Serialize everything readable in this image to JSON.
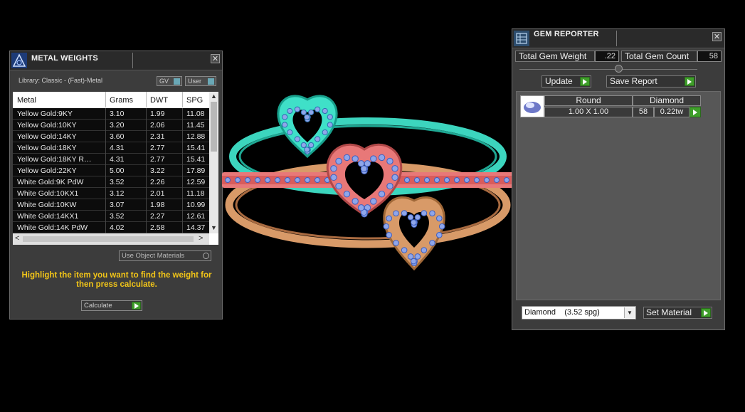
{
  "metal_weights": {
    "title": "METAL WEIGHTS",
    "library": "Library: Classic - (Fast)-Metal",
    "gv_label": "GV",
    "user_label": "User",
    "columns": [
      "Metal",
      "Grams",
      "DWT",
      "SPG"
    ],
    "rows": [
      [
        "Yellow Gold:9KY",
        "3.10",
        "1.99",
        "11.08"
      ],
      [
        "Yellow Gold:10KY",
        "3.20",
        "2.06",
        "11.45"
      ],
      [
        "Yellow Gold:14KY",
        "3.60",
        "2.31",
        "12.88"
      ],
      [
        "Yellow Gold:18KY",
        "4.31",
        "2.77",
        "15.41"
      ],
      [
        "Yellow Gold:18KY R…",
        "4.31",
        "2.77",
        "15.41"
      ],
      [
        "Yellow Gold:22KY",
        "5.00",
        "3.22",
        "17.89"
      ],
      [
        "White Gold:9K PdW",
        "3.52",
        "2.26",
        "12.59"
      ],
      [
        "White Gold:10KX1",
        "3.12",
        "2.01",
        "11.18"
      ],
      [
        "White Gold:10KW",
        "3.07",
        "1.98",
        "10.99"
      ],
      [
        "White Gold:14KX1",
        "3.52",
        "2.27",
        "12.61"
      ],
      [
        "White Gold:14K PdW",
        "4.02",
        "2.58",
        "14.37"
      ]
    ],
    "use_object_materials": "Use Object Materials",
    "hint": "Highlight the item you want to find the weight for then press calculate.",
    "calculate_label": "Calculate"
  },
  "gem_reporter": {
    "title": "GEM REPORTER",
    "total_weight_label": "Total Gem Weight",
    "total_weight_value": ".22",
    "total_count_label": "Total Gem Count",
    "total_count_value": "58",
    "update_label": "Update",
    "save_report_label": "Save Report",
    "table": {
      "shape_header": "Round",
      "material_header": "Diamond",
      "size": "1.00 X 1.00",
      "count": "58",
      "weight": "0.22tw"
    },
    "material_select": "Diamond    (3.52 spg)",
    "set_material_label": "Set Material"
  },
  "colors": {
    "panel_bg": "#3c3c3c",
    "hint_yellow": "#f2c518",
    "green_button": "#3f9e2a",
    "ring_cyan": "#3fe0c8",
    "ring_pink": "#e87878",
    "ring_copper": "#d89a68",
    "gem_blue": "#8fa6ea"
  },
  "icons": {
    "metal_weights_title": "metal-weights-app-icon",
    "gem_reporter_title": "gem-reporter-app-icon",
    "gem_thumbnail": "round-diamond-icon"
  }
}
